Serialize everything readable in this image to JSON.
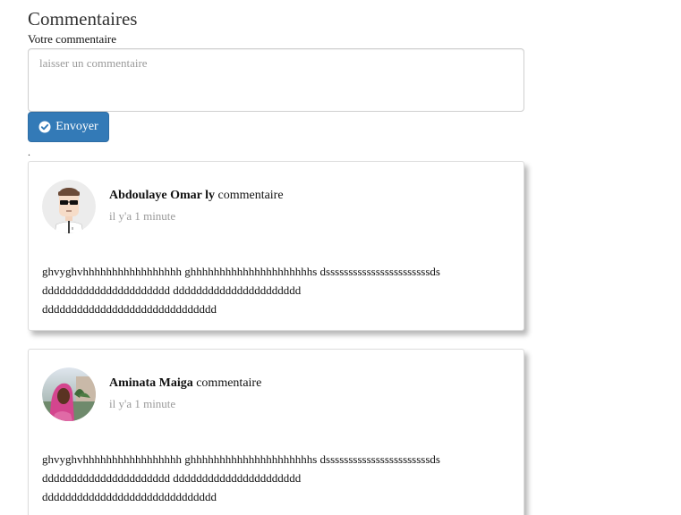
{
  "section": {
    "title": "Commentaires",
    "field_label": "Votre commentaire",
    "textarea_placeholder": "laisser un commentaire",
    "textarea_value": "",
    "send_label": "Envoyer",
    "separator": "."
  },
  "colors": {
    "button": "#337ab7",
    "time_text": "#9a9a9a"
  },
  "comments": [
    {
      "author": "Abdoulaye Omar ly",
      "action": "commentaire",
      "time": "il y'a 1 minute",
      "avatar": "cartoon-man-avatar",
      "lines": [
        "ghvyghvhhhhhhhhhhhhhhhhh ghhhhhhhhhhhhhhhhhhhhhs dsssssssssssssssssssssssds",
        "dddddddddddddddddddddd dddddddddddddddddddddd",
        "dddddddddddddddddddddddddddddd"
      ]
    },
    {
      "author": "Aminata Maiga",
      "action": "commentaire",
      "time": "il y'a 1 minute",
      "avatar": "woman-photo-avatar",
      "lines": [
        "ghvyghvhhhhhhhhhhhhhhhhh ghhhhhhhhhhhhhhhhhhhhhs dsssssssssssssssssssssssds",
        "dddddddddddddddddddddd dddddddddddddddddddddd",
        "dddddddddddddddddddddddddddddd"
      ]
    }
  ]
}
